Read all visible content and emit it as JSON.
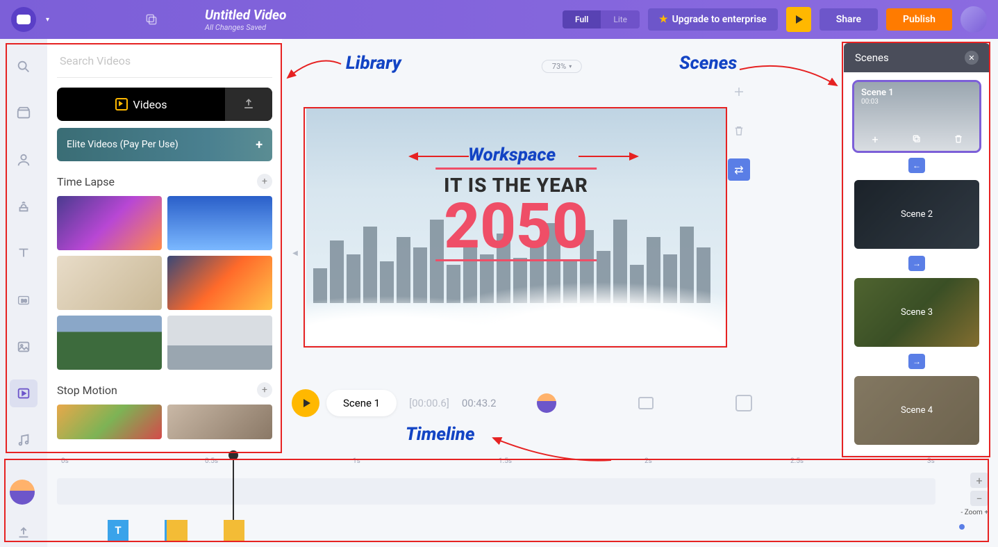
{
  "header": {
    "title": "Untitled Video",
    "subtitle": "All Changes Saved",
    "mode_full": "Full",
    "mode_lite": "Lite",
    "upgrade": "Upgrade to enterprise",
    "share": "Share",
    "publish": "Publish"
  },
  "library": {
    "search_placeholder": "Search Videos",
    "videos_tab": "Videos",
    "elite": "Elite Videos (Pay Per Use)",
    "section1": "Time Lapse",
    "section2": "Stop Motion"
  },
  "canvas": {
    "zoom": "73%",
    "line1": "IT IS THE YEAR",
    "line2": "2050"
  },
  "timeline": {
    "scene_label": "Scene 1",
    "time_current": "[00:00.6]",
    "time_total": "00:43.2",
    "ticks": [
      "0s",
      "0.5s",
      "1s",
      "1.5s",
      "2s",
      "2.5s",
      "3s"
    ],
    "clip_t": "T",
    "zoom_label": "Zoom"
  },
  "scenes": {
    "title": "Scenes",
    "items": [
      {
        "name": "Scene 1",
        "dur": "00:03"
      },
      {
        "name": "Scene 2"
      },
      {
        "name": "Scene 3"
      },
      {
        "name": "Scene 4"
      }
    ]
  },
  "annotations": {
    "library": "Library",
    "workspace": "Workspace",
    "scenes": "Scenes",
    "timeline": "Timeline"
  }
}
